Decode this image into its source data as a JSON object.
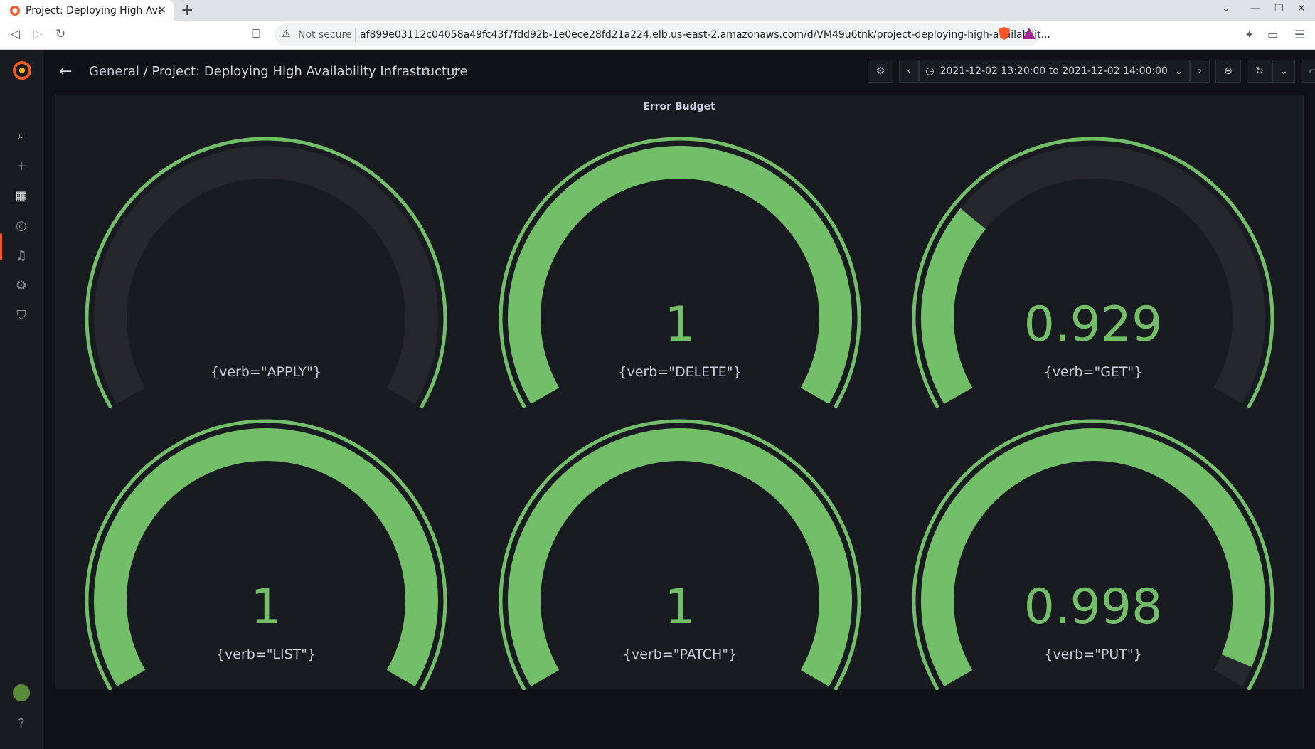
{
  "browser": {
    "tab_title": "Project: Deploying High Availability Infrastructure",
    "security_label": "Not secure",
    "url": "af899e03112c04058a49fc43f7fdd92b-1e0ece28fd21a224.elb.us-east-2.amazonaws.com/d/VM49u6tnk/project-deploying-high-availabilit..."
  },
  "header": {
    "folder": "General",
    "separator": "/",
    "dashboard_title": "Project: Deploying High Availability Infrastructure",
    "time_range": "2021-12-02 13:20:00 to 2021-12-02 14:00:00"
  },
  "panel": {
    "title": "Error Budget",
    "gauges": [
      {
        "label": "{verb=\"APPLY\"}",
        "value": "",
        "fraction": 0
      },
      {
        "label": "{verb=\"DELETE\"}",
        "value": "1",
        "fraction": 1
      },
      {
        "label": "{verb=\"GET\"}",
        "value": "0.929",
        "fraction": 0.29
      },
      {
        "label": "{verb=\"LIST\"}",
        "value": "1",
        "fraction": 1
      },
      {
        "label": "{verb=\"PATCH\"}",
        "value": "1",
        "fraction": 1
      },
      {
        "label": "{verb=\"PUT\"}",
        "value": "0.998",
        "fraction": 0.97
      }
    ]
  },
  "colors": {
    "gauge_fill": "#73bf69",
    "gauge_track": "#25272c",
    "threshold": "#73bf69",
    "accent": "#f05a28"
  },
  "icons": {
    "sidebar": [
      "search-icon",
      "plus-icon",
      "dashboards-icon",
      "explore-icon",
      "bell-icon",
      "gear-icon",
      "shield-icon"
    ],
    "help": "help-icon"
  }
}
